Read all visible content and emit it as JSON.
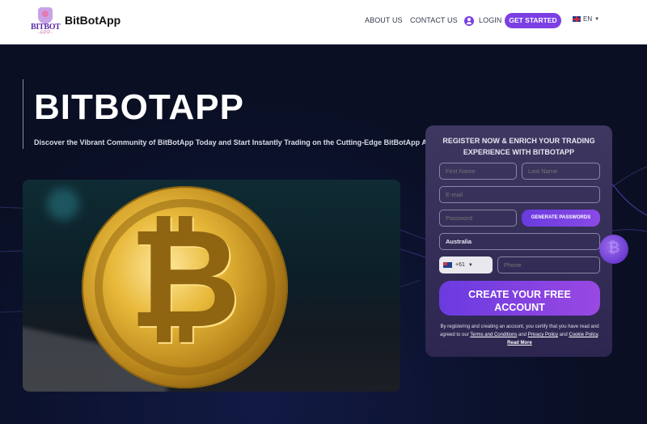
{
  "header": {
    "brand_name": "BitBotApp",
    "logo_text_top": "BITBOT",
    "logo_text_bottom": "-APP-",
    "nav": {
      "about": "ABOUT US",
      "contact": "CONTACT US",
      "login": "LOGIN",
      "get_started": "GET STARTED",
      "language": "EN"
    }
  },
  "hero": {
    "title": "BITBOTAPP",
    "subtitle": "Discover the Vibrant Community of BitBotApp Today and Start Instantly Trading on the Cutting-Edge BitBotApp App!",
    "image_glyph": "₿"
  },
  "form": {
    "title_line1": "REGISTER NOW & ENRICH YOUR TRADING",
    "title_line2": "EXPERIENCE WITH BITBOTAPP",
    "first_name_placeholder": "First Name",
    "last_name_placeholder": "Last Name",
    "email_placeholder": "E-mail",
    "password_placeholder": "Password",
    "generate_label": "GENERATE PASSWORDS",
    "country_value": "Australia",
    "phone_code": "+61",
    "phone_placeholder": "Phone",
    "create_label_line1": "CREATE YOUR FREE",
    "create_label_line2": "ACCOUNT",
    "disclaimer_text1": "By registering and creating an account, you certify that you have read and agreed to our ",
    "terms_link": "Terms and Conditions",
    "and1": " and ",
    "privacy_link": "Privacy Policy",
    "and2": " and ",
    "cookie_link": "Cookie Policy",
    "sep": ". ",
    "read_more_link": "Read More"
  },
  "decor": {
    "coin_glyph": "₿"
  }
}
